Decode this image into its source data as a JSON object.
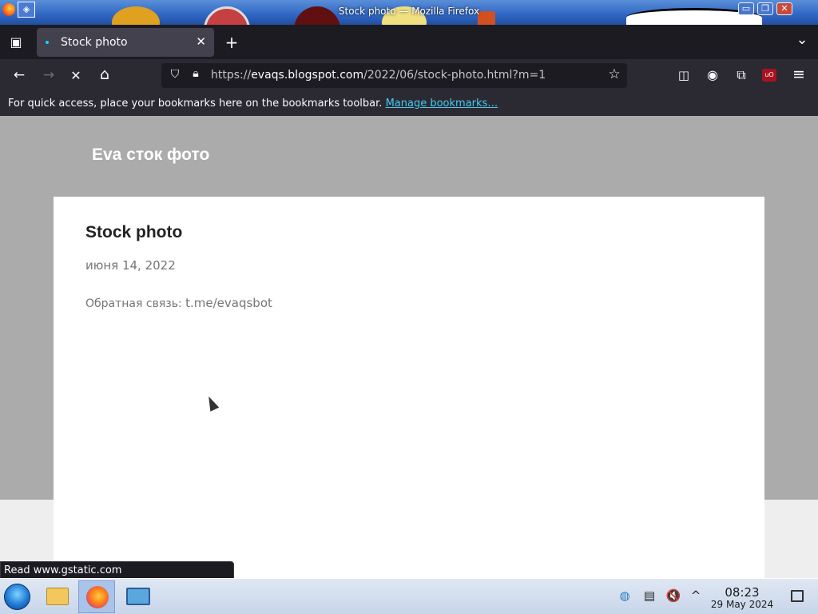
{
  "window": {
    "title": "Stock photo — Mozilla Firefox",
    "app_icon_glyph": "◈",
    "minimize_glyph": "▭",
    "restore_glyph": "❐",
    "close_glyph": "✕"
  },
  "tabs": {
    "list_all_glyph": "▣",
    "active_title": "Stock photo",
    "close_glyph": "✕",
    "new_tab_glyph": "+",
    "overflow_glyph": "⌄"
  },
  "nav": {
    "back_glyph": "←",
    "forward_glyph": "→",
    "stop_glyph": "✕",
    "home_glyph": "⌂",
    "url_scheme": "https://",
    "url_host": "evaqs.blogspot.com",
    "url_path": "/2022/06/stock-photo.html?m=1",
    "bookmark_glyph": "☆",
    "pocket_glyph": "◫",
    "account_glyph": "◉",
    "extensions_glyph": "⧉",
    "ublock_label": "uO",
    "menu_glyph": "≡"
  },
  "bookmarks_bar": {
    "message": "For quick access, place your bookmarks here on the bookmarks toolbar.",
    "manage_link": "Manage bookmarks…"
  },
  "blog": {
    "title": "Eva сток фото",
    "post_title": "Stock photo",
    "post_date": "июня 14, 2022",
    "feedback_label": "Обратная связь:",
    "feedback_link": "t.me/evaqsbot"
  },
  "status_bar": {
    "text": "Read www.gstatic.com"
  },
  "taskbar": {
    "time": "08:23",
    "date": "29 May 2024",
    "tray_update_glyph": "◍",
    "tray_clipboard_glyph": "▤",
    "tray_volume_glyph": "🔇",
    "tray_expand_glyph": "^"
  },
  "colors": {
    "accent_link": "#45caf0",
    "page_background": "#ababab",
    "toolbar": "#2b2a33"
  }
}
